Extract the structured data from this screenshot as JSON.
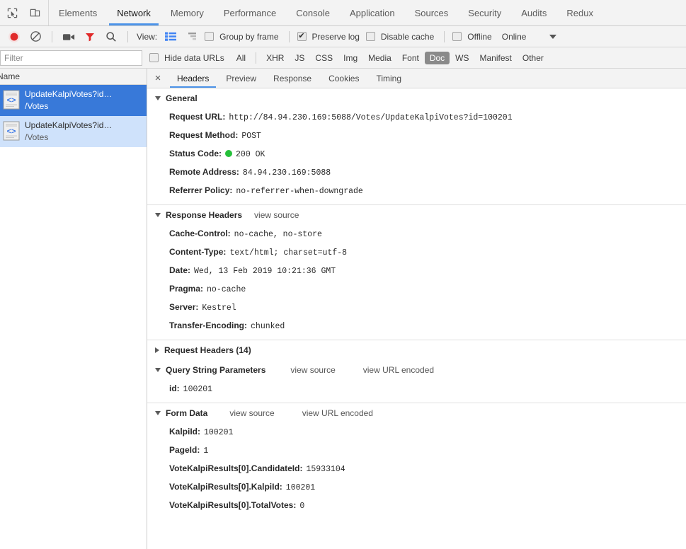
{
  "devtools": {
    "panel_tabs": [
      {
        "label": "Elements",
        "active": false
      },
      {
        "label": "Network",
        "active": true
      },
      {
        "label": "Memory",
        "active": false
      },
      {
        "label": "Performance",
        "active": false
      },
      {
        "label": "Console",
        "active": false
      },
      {
        "label": "Application",
        "active": false
      },
      {
        "label": "Sources",
        "active": false
      },
      {
        "label": "Security",
        "active": false
      },
      {
        "label": "Audits",
        "active": false
      },
      {
        "label": "Redux",
        "active": false
      }
    ],
    "inspect_icon": "inspect-element-icon",
    "device_icon": "device-toolbar-icon"
  },
  "toolbar": {
    "record_label": "record-button",
    "clear_label": "clear-button",
    "camera_label": "capture-screenshots-button",
    "filter_label": "filter-button",
    "search_label": "search-button",
    "view_label": "View:",
    "view_list_icon": "list-view-icon",
    "view_waterfall_icon": "waterfall-view-icon",
    "group_by_frame": {
      "label": "Group by frame",
      "checked": false
    },
    "preserve_log": {
      "label": "Preserve log",
      "checked": true
    },
    "disable_cache": {
      "label": "Disable cache",
      "checked": false
    },
    "offline": {
      "label": "Offline",
      "checked": false
    },
    "throttling": "Online",
    "record_active_color": "#e12a2a",
    "filter_active_color": "#e12a2a",
    "view_active_color": "#4285f4"
  },
  "filter_bar": {
    "placeholder": "Filter",
    "value": "",
    "hide_data_urls": {
      "label": "Hide data URLs",
      "checked": false
    },
    "types": [
      {
        "label": "All",
        "selected": false
      },
      {
        "label": "XHR",
        "selected": false
      },
      {
        "label": "JS",
        "selected": false
      },
      {
        "label": "CSS",
        "selected": false
      },
      {
        "label": "Img",
        "selected": false
      },
      {
        "label": "Media",
        "selected": false
      },
      {
        "label": "Font",
        "selected": false
      },
      {
        "label": "Doc",
        "selected": true
      },
      {
        "label": "WS",
        "selected": false
      },
      {
        "label": "Manifest",
        "selected": false
      },
      {
        "label": "Other",
        "selected": false
      }
    ]
  },
  "requests": {
    "column_header": "Name",
    "rows": [
      {
        "name": "UpdateKalpiVotes?id…",
        "path": "/Votes",
        "selected": true
      },
      {
        "name": "UpdateKalpiVotes?id…",
        "path": "/Votes",
        "selected": false
      }
    ]
  },
  "details": {
    "close_label": "×",
    "tabs": [
      {
        "label": "Headers",
        "active": true
      },
      {
        "label": "Preview",
        "active": false
      },
      {
        "label": "Response",
        "active": false
      },
      {
        "label": "Cookies",
        "active": false
      },
      {
        "label": "Timing",
        "active": false
      }
    ],
    "general": {
      "title": "General",
      "expanded": true,
      "rows": [
        {
          "key": "Request URL:",
          "value": "http://84.94.230.169:5088/Votes/UpdateKalpiVotes?id=100201"
        },
        {
          "key": "Request Method:",
          "value": "POST"
        },
        {
          "key": "Status Code:",
          "value": "200 OK",
          "status_dot": true
        },
        {
          "key": "Remote Address:",
          "value": "84.94.230.169:5088"
        },
        {
          "key": "Referrer Policy:",
          "value": "no-referrer-when-downgrade"
        }
      ]
    },
    "response_headers": {
      "title": "Response Headers",
      "expanded": true,
      "view_source": "view source",
      "rows": [
        {
          "key": "Cache-Control:",
          "value": "no-cache, no-store"
        },
        {
          "key": "Content-Type:",
          "value": "text/html; charset=utf-8"
        },
        {
          "key": "Date:",
          "value": "Wed, 13 Feb 2019 10:21:36 GMT"
        },
        {
          "key": "Pragma:",
          "value": "no-cache"
        },
        {
          "key": "Server:",
          "value": "Kestrel"
        },
        {
          "key": "Transfer-Encoding:",
          "value": "chunked"
        }
      ]
    },
    "request_headers": {
      "title": "Request Headers (14)",
      "expanded": false
    },
    "query_string": {
      "title": "Query String Parameters",
      "expanded": true,
      "view_source": "view source",
      "view_url_encoded": "view URL encoded",
      "rows": [
        {
          "key": "id:",
          "value": "100201"
        }
      ]
    },
    "form_data": {
      "title": "Form Data",
      "expanded": true,
      "view_source": "view source",
      "view_url_encoded": "view URL encoded",
      "rows": [
        {
          "key": "KalpiId:",
          "value": "100201"
        },
        {
          "key": "PageId:",
          "value": "1"
        },
        {
          "key": "VoteKalpiResults[0].CandidateId:",
          "value": "15933104"
        },
        {
          "key": "VoteKalpiResults[0].KalpiId:",
          "value": "100201"
        },
        {
          "key": "VoteKalpiResults[0].TotalVotes:",
          "value": "0"
        }
      ]
    }
  }
}
